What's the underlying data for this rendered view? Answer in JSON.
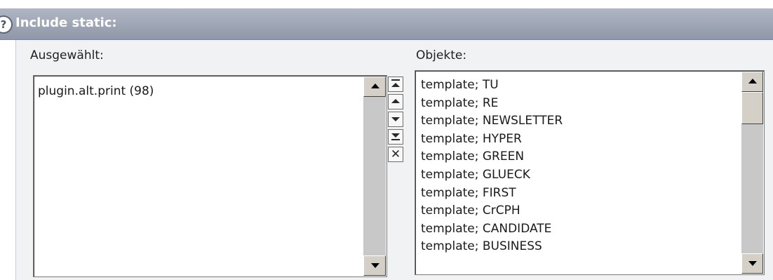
{
  "header": {
    "title": "Include static:"
  },
  "selected": {
    "label": "Ausgewählt:",
    "items": [
      "plugin.alt.print (98)"
    ]
  },
  "objects": {
    "label": "Objekte:",
    "items": [
      "template; TU",
      "template; RE",
      "template; NEWSLETTER",
      "template; HYPER",
      "template; GREEN",
      "template; GLUECK",
      "template; FIRST",
      "template; CrCPH",
      "template; CANDIDATE",
      "template; BUSINESS"
    ]
  },
  "controls": {
    "move_buttons": [
      "move-to-top-icon",
      "move-up-icon",
      "move-down-icon",
      "move-to-bottom-icon",
      "remove-icon"
    ]
  },
  "colors": {
    "header_bg": "#9aa1b1",
    "content_bg": "#f1f2f4"
  }
}
